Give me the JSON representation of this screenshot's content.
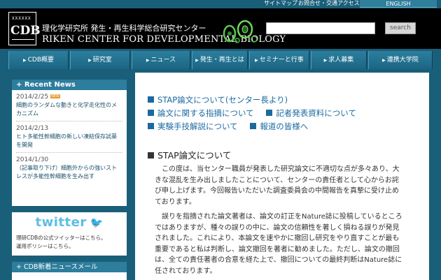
{
  "topbar": {
    "sitemap": "サイトマップ",
    "contact": "お問合せ・交通アクセス",
    "english": "ENGLISH"
  },
  "header": {
    "logo_dots": "XXXXXX",
    "logo_text": "CDB",
    "org_jp": "理化学研究所  発生・再生科学総合研究センター",
    "org_en": "RIKEN  CENTER FOR DEVELOPMENTAL BIOLOGY"
  },
  "search": {
    "value": "",
    "button_label": "search"
  },
  "nav": {
    "items": [
      {
        "label": "CDB概要"
      },
      {
        "label": "研究室"
      },
      {
        "label": "ニュース"
      },
      {
        "label": "発生・再生とは"
      },
      {
        "label": "セミナーと行事"
      },
      {
        "label": "求人募集"
      },
      {
        "label": "連携大学院"
      }
    ]
  },
  "sidebar": {
    "recent_news_title": "Recent News",
    "news": [
      {
        "date": "2014/2/25",
        "badge": "NEW",
        "text1": "細胞のランダムな動きと化学走化性のメ",
        "text2": "カニズム"
      },
      {
        "date": "2014/2/13",
        "badge": "",
        "text1": "ヒト多能性幹細胞の新しい凍結保存試薬",
        "text2": "を開発"
      },
      {
        "date": "2014/1/30",
        "badge": "",
        "text1": "（記事取り下げ）細胞外からの強いスト",
        "text2": "レスが多能性幹細胞を生み出す"
      }
    ],
    "twitter_logo": "twitter",
    "twitter_desc1": "理研CDBの公式ツイッターはこちら。",
    "twitter_desc2": "運用ポリシーはこちら。",
    "newsletter_title": "CDB新着ニュースメール"
  },
  "main": {
    "links": [
      {
        "row": [
          "STAP論文について(センター長より)"
        ]
      },
      {
        "row": [
          "論文に関する指摘について",
          "記者発表資料について"
        ]
      },
      {
        "row": [
          "実験手技解説について",
          "報道の皆様へ"
        ]
      }
    ],
    "section_title": "STAP論文について",
    "para1": [
      "この度は、当センター職員が発表した研究論文に不適切な点が多々あり、大",
      "きな混乱を生み出しましたことについて、センターの責任者として心からお詫",
      "び申し上げます。今回報告いただいた調査委員会の中間報告を真摯に受け止め",
      "ております。"
    ],
    "para2": [
      "誤りを指摘された論文著者は、論文の訂正をNature誌に投稿しているところ",
      "ではありますが、種々の誤りの中に、論文の信頼性を著しく損ねる誤りが発見",
      "されました。これにより、本論文を速やかに撤回し研究をやり直すことが最も",
      "重要であると私は判断し、論文撤回を著者に勧めました。ただし、論文の撤回",
      "は、全ての責任著者の合意を経た上で、撤回についての最終判断はNature誌に",
      "任されております。"
    ]
  },
  "colors": {
    "page_bg": "#1a5f7a",
    "link_blue": "#1a6aa0",
    "header_bg": "#000000",
    "new_badge": "#e79a2e",
    "twitter": "#5bbfe3"
  }
}
